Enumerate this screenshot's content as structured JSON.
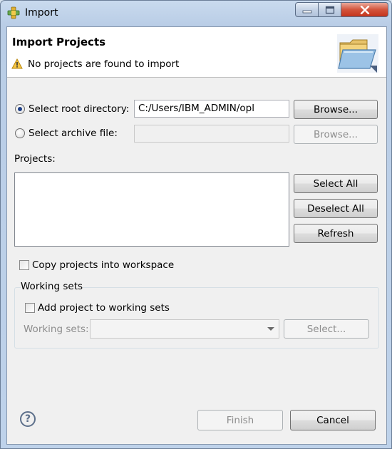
{
  "window": {
    "title": "Import",
    "app_icon": "eclipse-plugin-icon"
  },
  "banner": {
    "title": "Import Projects",
    "message": "No projects are found to import",
    "message_icon": "warning-icon",
    "graphic_icon": "folder-icon"
  },
  "root_directory": {
    "label": "Select root directory:",
    "value": "C:/Users/IBM_ADMIN/opl",
    "selected": true,
    "browse_label": "Browse..."
  },
  "archive_file": {
    "label": "Select archive file:",
    "value": "",
    "selected": false,
    "browse_label": "Browse..."
  },
  "projects": {
    "label": "Projects:",
    "items": [],
    "select_all_label": "Select All",
    "deselect_all_label": "Deselect All",
    "refresh_label": "Refresh"
  },
  "copy_projects": {
    "label": "Copy projects into workspace",
    "checked": false
  },
  "working_sets": {
    "group_title": "Working sets",
    "add_label": "Add project to working sets",
    "add_checked": false,
    "combo_label": "Working sets:",
    "combo_value": "",
    "select_label": "Select..."
  },
  "footer": {
    "help_icon": "help-icon",
    "finish_label": "Finish",
    "cancel_label": "Cancel"
  }
}
